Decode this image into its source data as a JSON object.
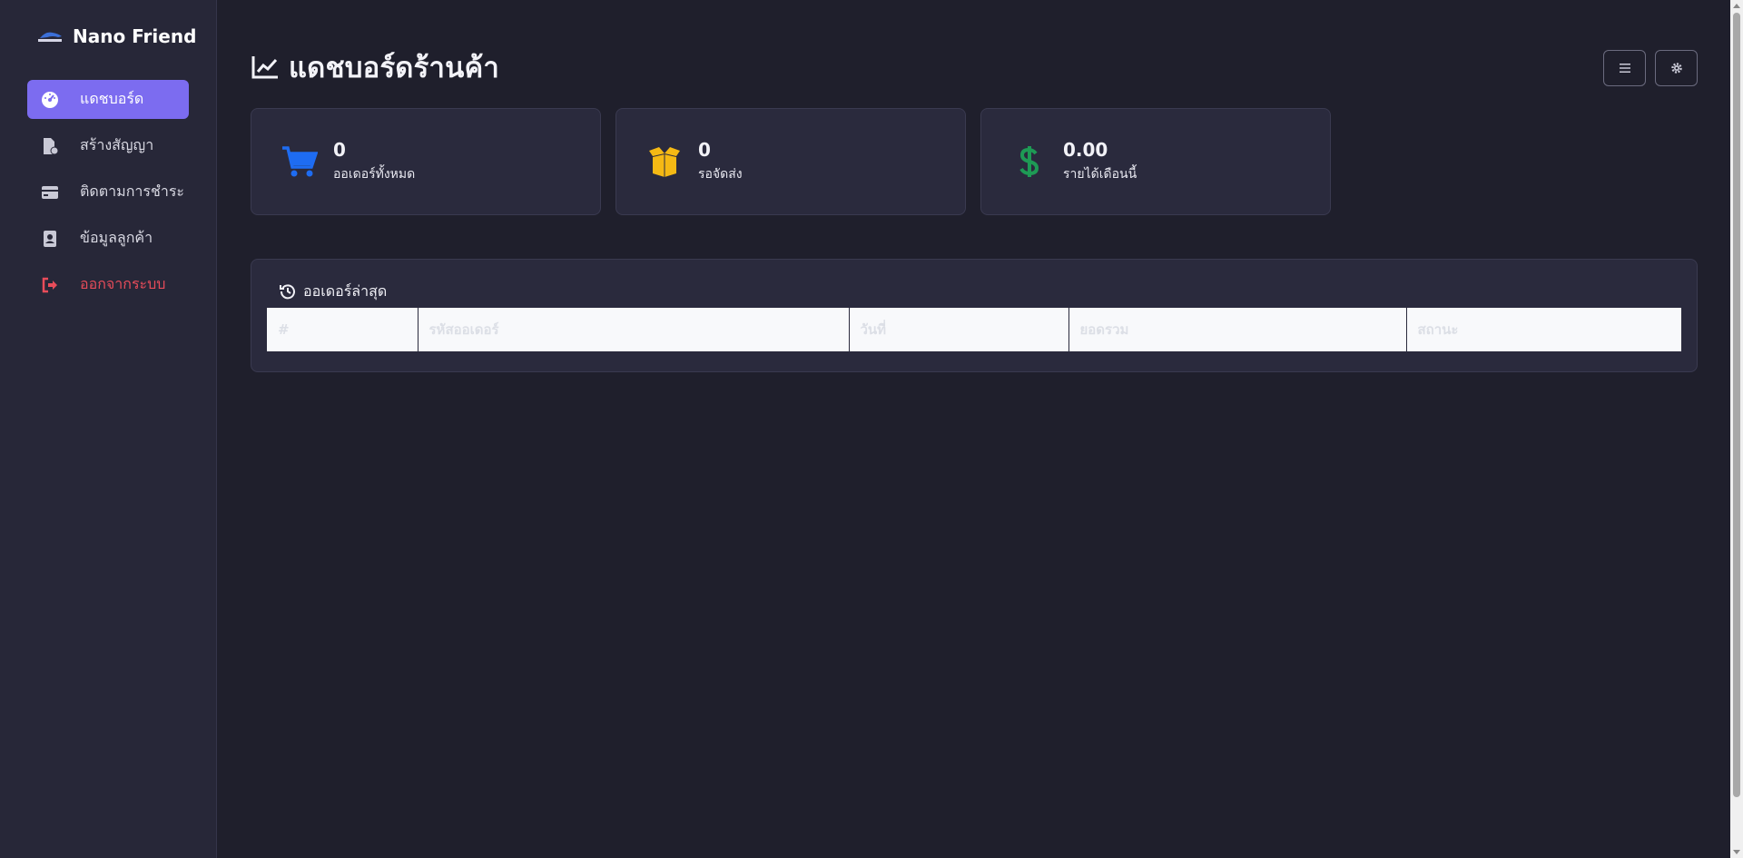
{
  "brand": {
    "name": "Nano Friend",
    "logo_icon": "nano-logo"
  },
  "sidebar": {
    "items": [
      {
        "label": "แดชบอร์ด",
        "icon": "dashboard-gauge-icon",
        "active": true
      },
      {
        "label": "สร้างสัญญา",
        "icon": "file-contract-icon"
      },
      {
        "label": "ติดตามการชำระ",
        "icon": "credit-card-icon"
      },
      {
        "label": "ข้อมูลลูกค้า",
        "icon": "address-book-icon"
      },
      {
        "label": "ออกจากระบบ",
        "icon": "logout-icon",
        "danger": true
      }
    ]
  },
  "header": {
    "title": "แดชบอร์ดร้านค้า",
    "title_icon": "line-chart-icon",
    "buttons": [
      {
        "icon": "hamburger-menu-icon"
      },
      {
        "icon": "settings-gear-icon"
      }
    ]
  },
  "stats": [
    {
      "value": "0",
      "label": "ออเดอร์ทั้งหมด",
      "icon": "cart-icon",
      "color": "#1e6cf2"
    },
    {
      "value": "0",
      "label": "รอจัดส่ง",
      "icon": "box-open-icon",
      "color": "#f5b914"
    },
    {
      "value": "0.00",
      "label": "รายได้เดือนนี้",
      "icon": "dollar-icon",
      "color": "#1e9a55"
    }
  ],
  "orders": {
    "title": "ออเดอร์ล่าสุด",
    "icon": "history-icon",
    "columns": [
      "#",
      "รหัสออเดอร์",
      "วันที่",
      "ยอดรวม",
      "สถานะ"
    ]
  },
  "colors": {
    "background": "#1f1f2c",
    "sidebar": "#272738",
    "card": "#2a2a3d",
    "accent": "#7c6cf0",
    "danger": "#e84c5a"
  }
}
